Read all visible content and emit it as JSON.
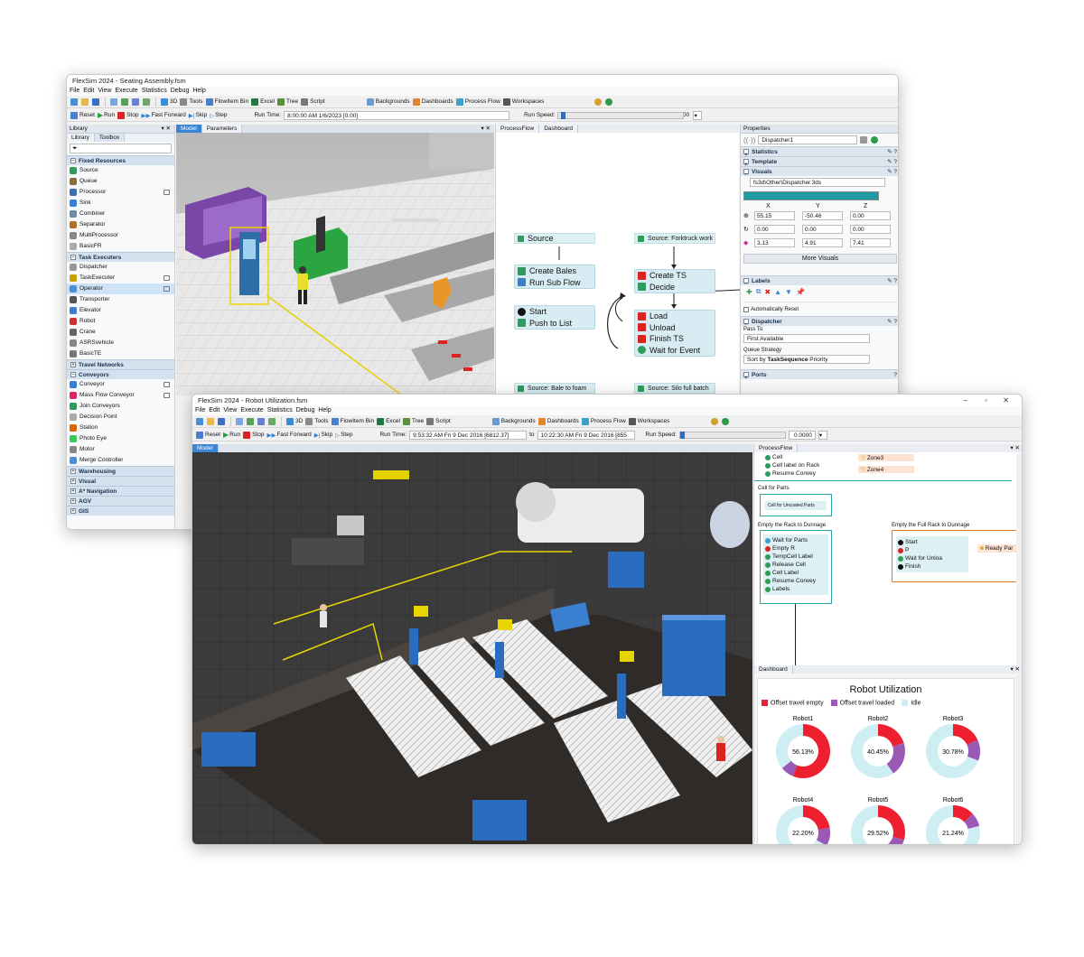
{
  "colors": {
    "accent": "#3c84d6",
    "red": "#ee1f2e",
    "purple": "#9b59b6",
    "idle": "#cfeef4",
    "teal": "#1e9aa0"
  },
  "w1": {
    "title": "FlexSim 2024 - Seating Assembly.fsm",
    "menu": [
      "File",
      "Edit",
      "View",
      "Execute",
      "Statistics",
      "Debug",
      "Help"
    ],
    "toolbar1": [
      "3D",
      "Tools",
      "FlowItem Bin",
      "Excel",
      "Tree",
      "Script",
      "Backgrounds",
      "Dashboards",
      "Process Flow",
      "Workspaces"
    ],
    "toolbar2": {
      "reset": "Reset",
      "run": "Run",
      "stop": "Stop",
      "ff": "Fast Forward",
      "skip": "Skip",
      "step": "Step",
      "run_time_label": "Run Time:",
      "run_time": "8:00:00 AM  1/6/2023  [0.00]",
      "run_speed_label": "Run Speed:",
      "run_speed": "4.00",
      "run_speed_level": 0.02
    },
    "library": {
      "header": "Library",
      "tabs": [
        "Library",
        "Toolbox"
      ],
      "categories": [
        {
          "name": "Fixed Resources",
          "items": [
            "Source",
            "Queue",
            "Processor",
            "Sink",
            "Combiner",
            "Separator",
            "MultiProcessor",
            "BasicFR"
          ]
        },
        {
          "name": "Task Executers",
          "items": [
            "Dispatcher",
            "TaskExecuter",
            "Operator",
            "Transporter",
            "Elevator",
            "Robot",
            "Crane",
            "ASRSvehicle",
            "BasicTE"
          ]
        },
        {
          "name": "Travel Networks",
          "items": []
        },
        {
          "name": "Conveyors",
          "items": [
            "Conveyor",
            "Mass Flow Conveyor",
            "Join Conveyors",
            "Decision Point",
            "Station",
            "Photo Eye",
            "Motor",
            "Merge Controller"
          ]
        },
        {
          "name": "Warehousing",
          "items": []
        },
        {
          "name": "Visual",
          "items": []
        },
        {
          "name": "A* Navigation",
          "items": []
        },
        {
          "name": "AGV",
          "items": []
        },
        {
          "name": "GIS",
          "items": []
        }
      ]
    },
    "view_tabs": [
      "Model",
      "Parameters"
    ],
    "pf_tabs": [
      "ProcessFlow",
      "Dashboard"
    ],
    "process_flow": {
      "source": "Source",
      "create_bales": [
        "Create Bales",
        "Run Sub Flow"
      ],
      "start_push": [
        "Start",
        "Push to List"
      ],
      "bale_source": "Source: Bale to foam",
      "forktruck_source": "Source: Forktruck work",
      "create_ts": [
        "Create TS",
        "Decide"
      ],
      "tasks": [
        "Load",
        "Unload",
        "Finish TS",
        "Wait for Event"
      ],
      "silo_source": "Source: Silo full batch"
    },
    "properties": {
      "header": "Properties",
      "object_name": "Dispatcher1",
      "sections": [
        "Statistics",
        "Template",
        "Visuals"
      ],
      "shape_path": "fs3d\\Other\\Dispatcher.3ds",
      "xyz_headers": [
        "X",
        "Y",
        "Z"
      ],
      "position": [
        "55.15",
        "-50.46",
        "0.00"
      ],
      "rotation": [
        "0.00",
        "0.00",
        "0.00"
      ],
      "size": [
        "3.13",
        "4.91",
        "7.41"
      ],
      "more_visuals": "More Visuals",
      "labels_section": "Labels",
      "auto_reset": "Automatically Reset",
      "dispatcher_section": "Dispatcher",
      "pass_to_label": "Pass To",
      "pass_to": "First Available",
      "queue_strategy_label": "Queue Strategy",
      "queue_strategy_prefix": "Sort by",
      "queue_strategy_bold": "TaskSequence",
      "queue_strategy_suffix": "Priority",
      "ports_section": "Ports"
    }
  },
  "w2": {
    "title": "FlexSim 2024 - Robot Utilization.fsm",
    "menu": [
      "File",
      "Edit",
      "View",
      "Execute",
      "Statistics",
      "Debug",
      "Help"
    ],
    "toolbar1": [
      "3D",
      "Tools",
      "FlowItem Bin",
      "Excel",
      "Tree",
      "Script",
      "Backgrounds",
      "Dashboards",
      "Process Flow",
      "Workspaces"
    ],
    "toolbar2": {
      "reset": "Reset",
      "run": "Run",
      "stop": "Stop",
      "ff": "Fast Forward",
      "skip": "Skip",
      "step": "Step",
      "run_time_label": "Run Time:",
      "run_time": "9:53:32 AM  Fri 9 Dec 2016  [6812.37]",
      "to": "to",
      "end_time": "10:22:30 AM  Fri 9 Dec 2016  [855",
      "run_speed_label": "Run Speed:",
      "run_speed": "0.0000",
      "run_speed_level": 0.0
    },
    "model_tab": "Model",
    "pf_tab": "ProcessFlow",
    "process_flow": {
      "top_rows": [
        "Cell",
        "Cell label on Rack",
        "Resume Convey"
      ],
      "zones": [
        "Zone3",
        "Zone4"
      ],
      "cell_for_parts_title": "Cell for Parts",
      "cell_for_parts": "Cell for Uncoated Parts",
      "empty_rack_title": "Empty the Rack to Dunnage",
      "empty_rack_rows": [
        "Wait for Parts",
        "Empty R",
        "TempCell Label",
        "Release Cell",
        "Cell Label",
        "Resume Convey",
        "Labels"
      ],
      "full_rack_title": "Empty the Full Rack to Dunnage",
      "full_rack_rows": [
        "Start",
        "P",
        "Wait for Unloa",
        "Finish"
      ],
      "ready_part": "Ready Par"
    },
    "dashboard_tab": "Dashboard",
    "dashboard": {
      "title": "Robot Utilization",
      "legend": [
        "Offset travel empty",
        "Offset travel loaded",
        "Idle"
      ]
    }
  },
  "chart_data": {
    "type": "pie",
    "title": "Robot Utilization",
    "categories": [
      "Robot1",
      "Robot2",
      "Robot3",
      "Robot4",
      "Robot5",
      "Robot6"
    ],
    "series": [
      {
        "name": "Offset travel empty",
        "values": [
          56.13,
          20.1,
          18.2,
          22.2,
          29.52,
          13.0
        ]
      },
      {
        "name": "Offset travel loaded",
        "values": [
          8.0,
          20.35,
          12.5,
          11.0,
          12.0,
          8.24
        ]
      },
      {
        "name": "Idle",
        "values": [
          35.87,
          59.55,
          69.3,
          66.8,
          58.48,
          78.76
        ]
      }
    ],
    "labels": [
      "56.13%",
      "40.45%",
      "30.78%",
      "22.20%",
      "29.52%",
      "21.24%"
    ]
  }
}
